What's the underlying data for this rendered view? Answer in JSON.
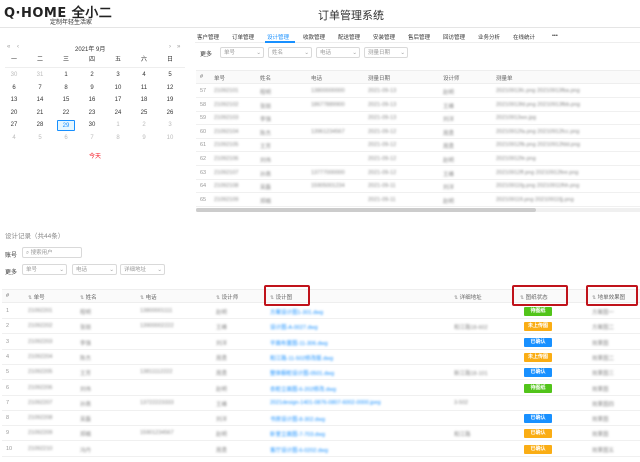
{
  "brand": {
    "logo": "Q·HOME 全小二",
    "slogan": "定制年轻生活家"
  },
  "app_title": "订单管理系统",
  "nav": [
    {
      "label": "客户管理"
    },
    {
      "label": "订单管理"
    },
    {
      "label": "设计管理"
    },
    {
      "label": "收款管理"
    },
    {
      "label": "配送管理"
    },
    {
      "label": "安装管理"
    },
    {
      "label": "售后管理"
    },
    {
      "label": "回访管理"
    },
    {
      "label": "业务分析"
    },
    {
      "label": "在线统计"
    },
    {
      "label": "•••"
    }
  ],
  "calendar": {
    "prev_year": "«",
    "prev_month": "‹",
    "title": "2021年  9月",
    "next_month": "›",
    "next_year": "»",
    "weekdays": [
      "一",
      "二",
      "三",
      "四",
      "五",
      "六",
      "日"
    ],
    "days": [
      [
        "30",
        "31",
        "1",
        "2",
        "3",
        "4",
        "5"
      ],
      [
        "6",
        "7",
        "8",
        "9",
        "10",
        "11",
        "12"
      ],
      [
        "13",
        "14",
        "15",
        "16",
        "17",
        "18",
        "19"
      ],
      [
        "20",
        "21",
        "22",
        "23",
        "24",
        "25",
        "26"
      ],
      [
        "27",
        "28",
        "29",
        "30",
        "1",
        "2",
        "3"
      ],
      [
        "4",
        "5",
        "6",
        "7",
        "8",
        "9",
        "10"
      ]
    ],
    "today_label": "今天"
  },
  "upper_filter": {
    "label": "更多",
    "fields": [
      "单号",
      "姓名",
      "电话",
      "测量日期"
    ]
  },
  "upper_table": {
    "columns": [
      "#",
      "单号",
      "姓名",
      "电话",
      "测量日期",
      "设计师",
      "测量单"
    ],
    "rows": [
      {
        "n": "57",
        "c": [
          "21092101",
          "程明",
          "13800000000",
          "2021-09-13",
          "赵明",
          "20210913fc.png 20210913fba.png"
        ]
      },
      {
        "n": "58",
        "c": [
          "21092102",
          "张丽",
          "18677889900",
          "2021-09-13",
          "王峰",
          "20210913fd.png 20210913fbb.png"
        ]
      },
      {
        "n": "59",
        "c": [
          "21092103",
          "李强",
          "",
          "2021-09-13",
          "刘洋",
          "20210913wx.jpg"
        ]
      },
      {
        "n": "60",
        "c": [
          "21092104",
          "陈杰",
          "13961234567",
          "2021-09-12",
          "周勇",
          "20210912fa.png 20210912fcc.png"
        ]
      },
      {
        "n": "61",
        "c": [
          "21092105",
          "王芳",
          "",
          "2021-09-12",
          "周勇",
          "20210912fb.png 20210912fdd.png"
        ]
      },
      {
        "n": "62",
        "c": [
          "21092106",
          "刘伟",
          "",
          "2021-09-12",
          "赵明",
          "20210912fe.png"
        ]
      },
      {
        "n": "63",
        "c": [
          "21092107",
          "孙燕",
          "13777000000",
          "2021-09-12",
          "王峰",
          "20210912ff.png 20210912fee.png"
        ]
      },
      {
        "n": "64",
        "c": [
          "21092108",
          "吴磊",
          "15905001234",
          "2021-09-11",
          "刘洋",
          "20210911fg.png 20210911fhh.png"
        ]
      },
      {
        "n": "65",
        "c": [
          "21092109",
          "郑楠",
          "",
          "2021-09-11",
          "赵明",
          "20210911fi.png 20210911fjj.png"
        ]
      }
    ]
  },
  "design": {
    "title": "设计记录（共44条）",
    "search_label": "账号",
    "search_placeholder": "搜索用户",
    "filter_label": "更多",
    "filters": [
      "单号",
      "电话",
      "详细地址"
    ],
    "columns": [
      "#",
      "单号",
      "姓名",
      "电话",
      "设计师",
      "设计图",
      "详细地址",
      "图纸状态",
      "地单效果图"
    ],
    "rows": [
      {
        "n": "1",
        "c": [
          "21092201",
          "程明",
          "13800001111",
          "赵明",
          "方案设计图1-301.dwg",
          "",
          "",
          "方案图一"
        ],
        "tag": {
          "text": "待图纸",
          "color": "tg"
        }
      },
      {
        "n": "2",
        "c": [
          "21092202",
          "张丽",
          "13900002222",
          "王峰",
          "设计图-A-0027.dwg",
          "和江路18-602",
          "",
          "方案图二"
        ],
        "tag": {
          "text": "未上传图",
          "color": "to"
        }
      },
      {
        "n": "3",
        "c": [
          "21092203",
          "李强",
          "",
          "刘洋",
          "平面布置图-11-306.dwg",
          "",
          "",
          "效果图"
        ],
        "tag": {
          "text": "已确认",
          "color": "tb"
        }
      },
      {
        "n": "4",
        "c": [
          "21092204",
          "陈杰",
          "",
          "周勇",
          "和江路-11-502修改版.dwg",
          "",
          "",
          "效果图二"
        ],
        "tag": {
          "text": "未上传图",
          "color": "to"
        }
      },
      {
        "n": "5",
        "c": [
          "21092205",
          "王芳",
          "13811112222",
          "周勇",
          "整体橱柜设计图-0501.dwg",
          "新江路18-101",
          "",
          "效果图三"
        ],
        "tag": {
          "text": "已确认",
          "color": "tb"
        }
      },
      {
        "n": "6",
        "c": [
          "21092206",
          "刘伟",
          "",
          "赵明",
          "衣柜立面图-6-202修改.dwg",
          "",
          "",
          "效果图"
        ],
        "tag": {
          "text": "待图纸",
          "color": "tg"
        }
      },
      {
        "n": "7",
        "c": [
          "21092207",
          "孙燕",
          "13722223333",
          "王峰",
          "2021design-1401-0876-0807-6002-0000.jpeg",
          "3-502",
          "",
          "效果图四"
        ],
        "tag": null
      },
      {
        "n": "8",
        "c": [
          "21092208",
          "吴磊",
          "",
          "刘洋",
          "书房设计图-8-302.dwg",
          "",
          "",
          "效果图"
        ],
        "tag": {
          "text": "已确认",
          "color": "tb"
        }
      },
      {
        "n": "9",
        "c": [
          "21092209",
          "郑楠",
          "15901234567",
          "赵明",
          "卧室立面图-7-703.dwg",
          "和江路",
          "",
          "效果图"
        ],
        "tag": {
          "text": "已确认",
          "color": "to"
        }
      },
      {
        "n": "10",
        "c": [
          "21092210",
          "冯丹",
          "",
          "周勇",
          "客厅设计图-6-0202.dwg",
          "",
          "",
          "效果图五"
        ],
        "tag": {
          "text": "已确认",
          "color": "to"
        }
      }
    ]
  },
  "icons": {
    "sort": "sort-icon",
    "dropdown": "chevron-down-icon"
  },
  "colors": {
    "accent": "#1890ff",
    "highlight": "#c0131b",
    "green": "#52c41a",
    "orange": "#faad14",
    "blue": "#1890ff"
  }
}
